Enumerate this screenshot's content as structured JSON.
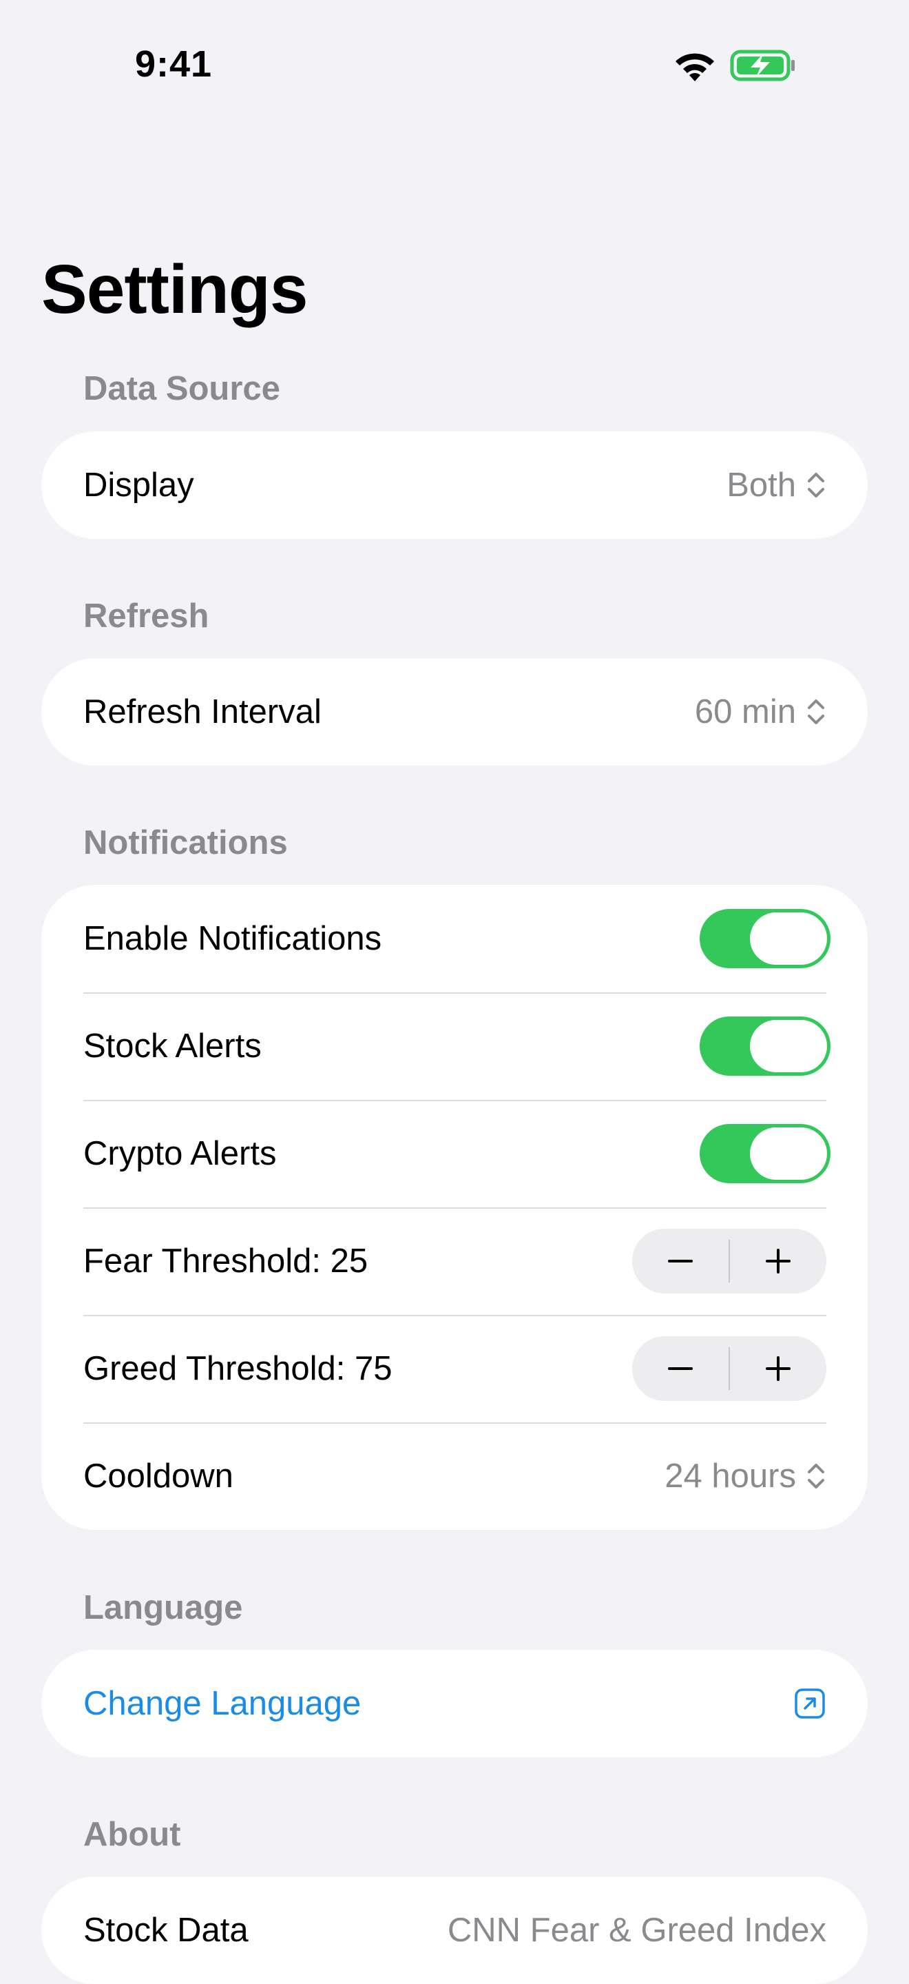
{
  "status_bar": {
    "time": "9:41",
    "wifi_icon": "wifi-icon",
    "battery_icon": "battery-charging-icon",
    "battery_color": "#34C759"
  },
  "page": {
    "title": "Settings"
  },
  "sections": {
    "data_source": {
      "header": "Data Source",
      "display_label": "Display",
      "display_value": "Both"
    },
    "refresh": {
      "header": "Refresh",
      "interval_label": "Refresh Interval",
      "interval_value": "60 min"
    },
    "notifications": {
      "header": "Notifications",
      "enable_label": "Enable Notifications",
      "enable_on": true,
      "stock_label": "Stock Alerts",
      "stock_on": true,
      "crypto_label": "Crypto Alerts",
      "crypto_on": true,
      "fear_label": "Fear Threshold: 25",
      "greed_label": "Greed Threshold: 75",
      "cooldown_label": "Cooldown",
      "cooldown_value": "24 hours"
    },
    "language": {
      "header": "Language",
      "change_label": "Change Language"
    },
    "about": {
      "header": "About",
      "stock_data_label": "Stock Data",
      "stock_data_value": "CNN Fear & Greed Index"
    }
  },
  "colors": {
    "background": "#F2F2F7",
    "accent_blue": "#1A8CE6",
    "toggle_on": "#34C759",
    "secondary_text": "#8A8A8E"
  }
}
